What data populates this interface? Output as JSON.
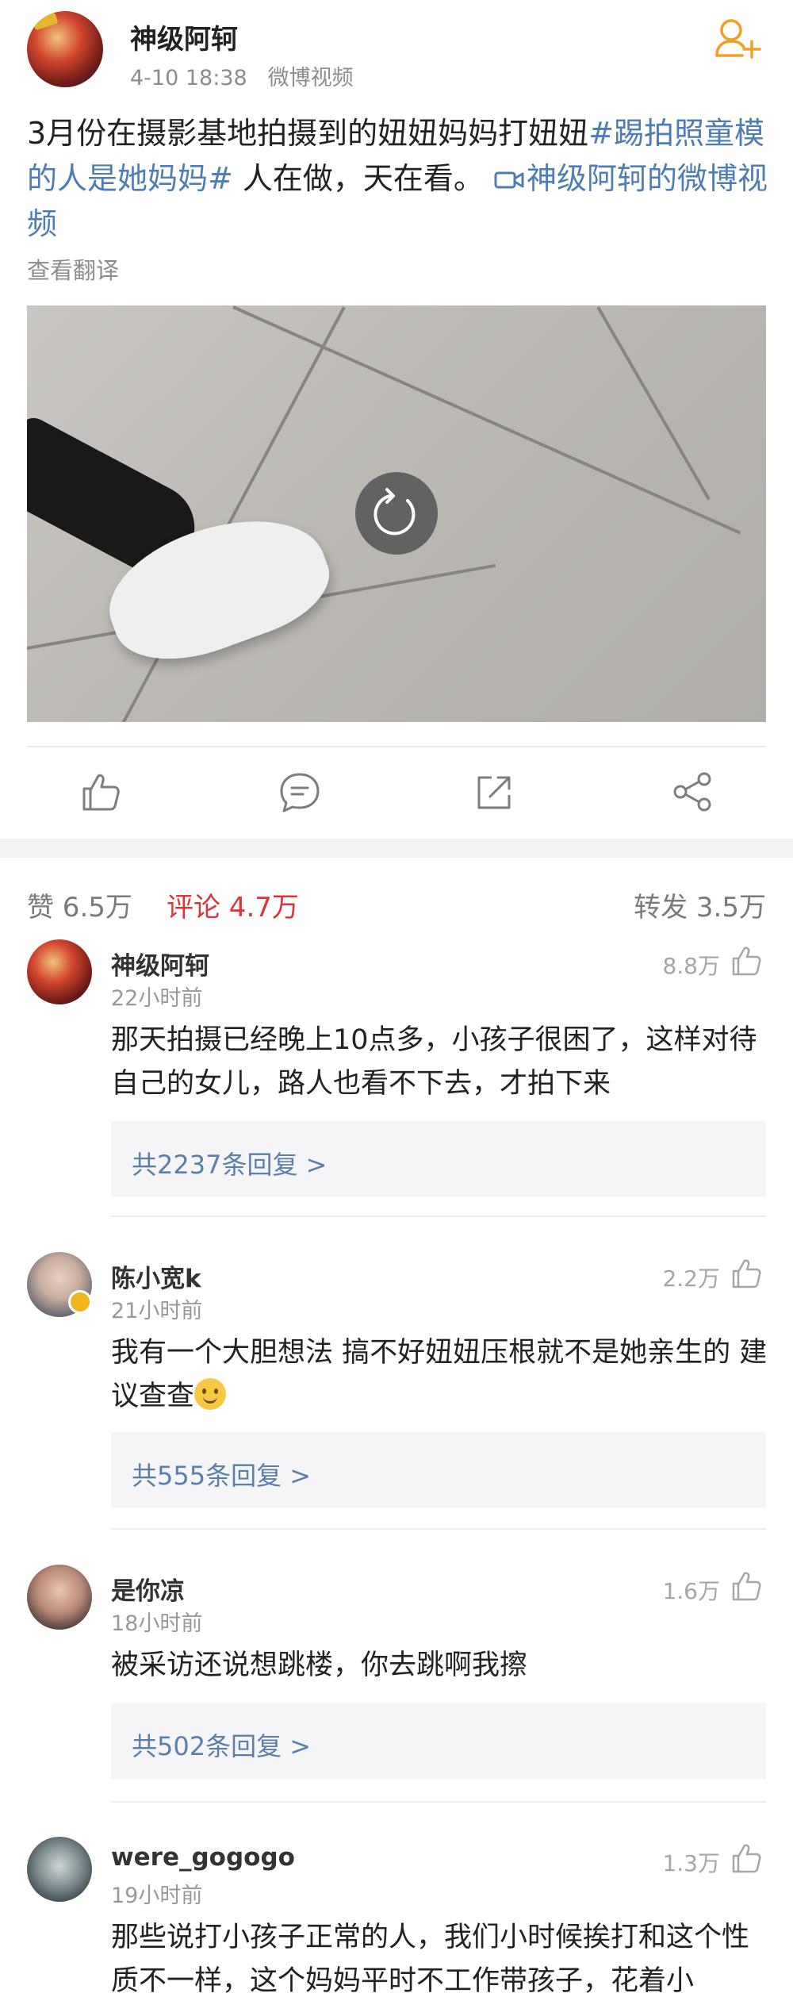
{
  "post": {
    "author": "神级阿轲",
    "timestamp": "4-10 18:38",
    "source": "微博视频",
    "text_plain": "3月份在摄影基地拍摄到的妞妞妈妈打妞妞",
    "hashtag": "#踢拍照童模的人是她妈妈#",
    "text_after": " 人在做，天在看。 ",
    "video_link": "神级阿轲的微博视频",
    "translate_label": "查看翻译"
  },
  "icons": {
    "follow": "add-friend-icon",
    "replay": "replay-icon",
    "like": "thumbs-up-icon",
    "comment": "comment-icon",
    "repost": "repost-icon",
    "share": "share-icon",
    "video": "video-camera-icon"
  },
  "colors": {
    "link": "#4f7db3",
    "active_tab": "#d7373a",
    "muted": "#8c8c8c",
    "reply_box": "#f5f5f7"
  },
  "stats": {
    "likes_label": "赞 6.5万",
    "comments_label": "评论 4.7万",
    "reposts_label": "转发 3.5万"
  },
  "comments": [
    {
      "user": "神级阿轲",
      "time": "22小时前",
      "likes": "8.8万",
      "text": "那天拍摄已经晚上10点多，小孩子很困了，这样对待自己的女儿，路人也看不下去，才拍下来",
      "replies": "共2237条回复 >"
    },
    {
      "user": "陈小宽k",
      "time": "21小时前",
      "likes": "2.2万",
      "text": "我有一个大胆想法 搞不好妞妞压根就不是她亲生的 建议查查",
      "replies": "共555条回复 >"
    },
    {
      "user": "是你凉",
      "time": "18小时前",
      "likes": "1.6万",
      "text": "被采访还说想跳楼，你去跳啊我擦",
      "replies": "共502条回复 >"
    },
    {
      "user": "were_gogogo",
      "time": "19小时前",
      "likes": "1.3万",
      "text": "那些说打小孩子正常的人，我们小时候挨打和这个性质不一样，这个妈妈平时不工作带孩子，花着小"
    }
  ]
}
